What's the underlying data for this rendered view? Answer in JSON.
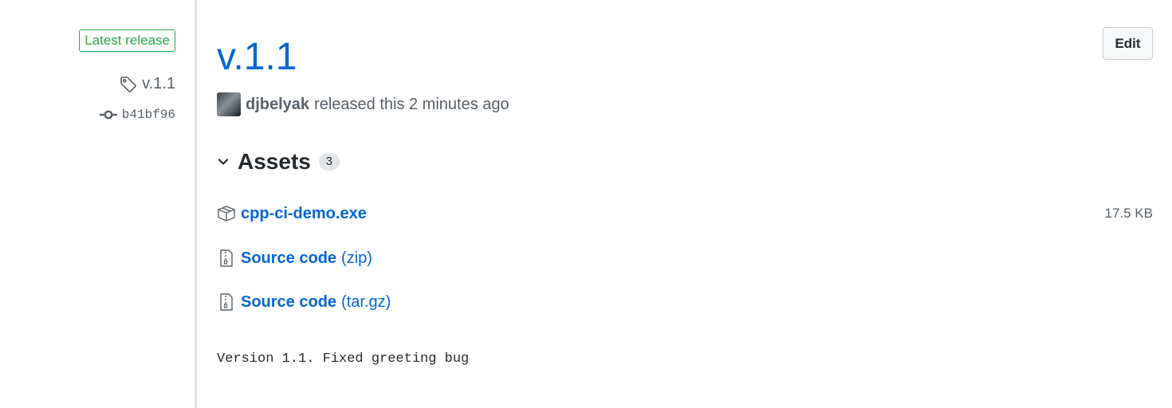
{
  "sidebar": {
    "badge": "Latest release",
    "tag": "v.1.1",
    "commit": "b41bf96",
    "icons": {
      "tag": "tag-icon",
      "commit": "git-commit-icon"
    }
  },
  "release": {
    "title": "v.1.1",
    "edit_label": "Edit",
    "author": "djbelyak",
    "released_text": "released this 2 minutes ago"
  },
  "assets": {
    "title": "Assets",
    "count": "3",
    "items": [
      {
        "name": "cpp-ci-demo.exe",
        "suffix": "",
        "size": "17.5 KB",
        "icon": "package-icon"
      },
      {
        "name": "Source code",
        "suffix": "(zip)",
        "size": "",
        "icon": "file-zip-icon"
      },
      {
        "name": "Source code",
        "suffix": "(tar.gz)",
        "size": "",
        "icon": "file-zip-icon"
      }
    ]
  },
  "notes": "Version 1.1. Fixed greeting bug",
  "colors": {
    "link": "#0366d6",
    "badge_green": "#28a745",
    "muted": "#586069",
    "divider": "#e1e4e8"
  }
}
